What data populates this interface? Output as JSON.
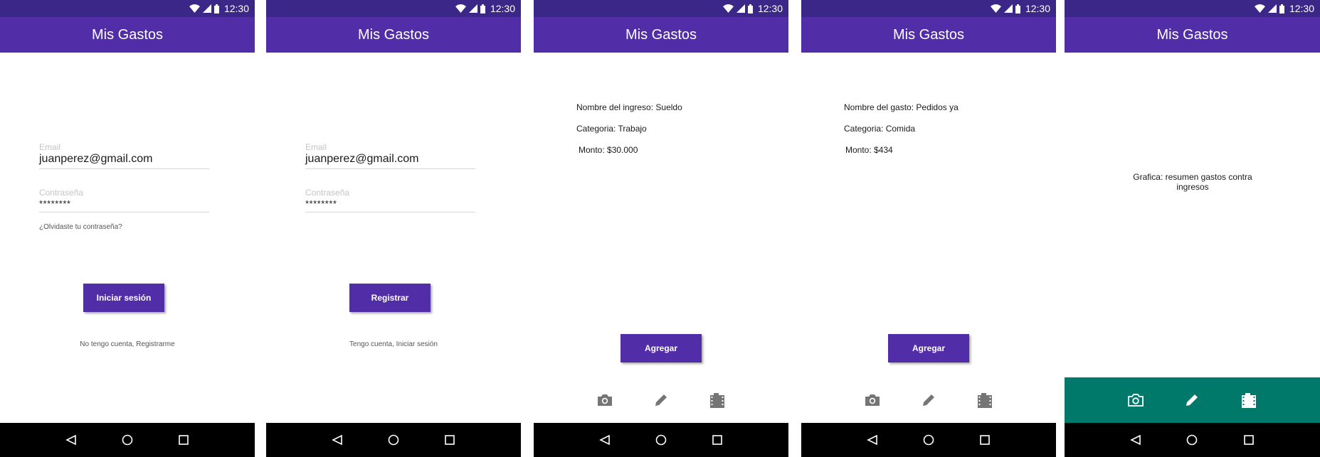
{
  "status": {
    "time": "12:30"
  },
  "app": {
    "title": "Mis Gastos"
  },
  "login": {
    "email_label": "Email",
    "email_value": "juanperez@gmail.com",
    "password_label": "Contraseña",
    "password_value": "********",
    "forgot": "¿Olvidaste tu contraseña?",
    "button": "Iniciar sesión",
    "register_link": "No tengo cuenta, Registrarme"
  },
  "register": {
    "email_label": "Email",
    "email_value": "juanperez@gmail.com",
    "password_label": "Contraseña",
    "password_value": "********",
    "button": "Registrar",
    "login_link": "Tengo cuenta, Iniciar sesión"
  },
  "income": {
    "name": "Nombre del ingreso: Sueldo",
    "category": "Categoria: Trabajo",
    "amount": "Monto: $30.000",
    "button": "Agregar"
  },
  "expense": {
    "name": "Nombre del gasto: Pedidos ya",
    "category": "Categoria: Comida",
    "amount": "Monto: $434",
    "button": "Agregar"
  },
  "graph": {
    "text": "Grafica: resumen gastos contra ingresos"
  },
  "icons": {
    "toolbar": [
      "camera-icon",
      "pencil-icon",
      "movie-icon"
    ],
    "nav": [
      "back-icon",
      "home-icon",
      "recents-icon"
    ]
  },
  "colors": {
    "statusbar": "#3a2788",
    "appbar": "#512da8",
    "button": "#512da8",
    "toolbar_teal": "#00796b",
    "navbar": "#000000",
    "icon_gray": "#757575"
  }
}
